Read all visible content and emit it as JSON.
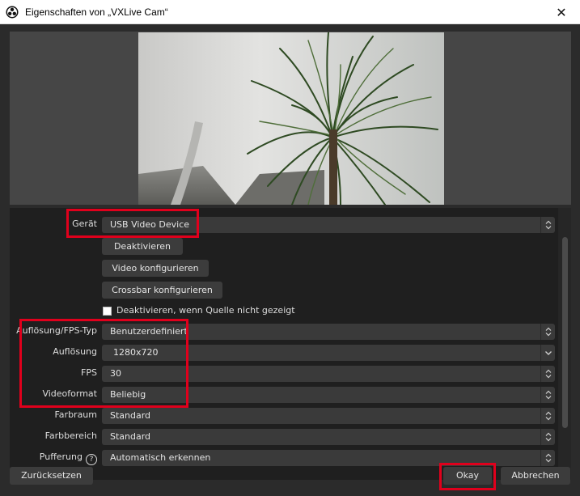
{
  "window": {
    "title": "Eigenschaften von „VXLive Cam“",
    "close_glyph": "✕"
  },
  "properties": {
    "device": {
      "label": "Gerät",
      "value": "USB Video Device"
    },
    "deactivate_button": "Deaktivieren",
    "configure_video_button": "Video konfigurieren",
    "configure_crossbar_button": "Crossbar konfigurieren",
    "deactivate_when_hidden": {
      "label": "Deaktivieren, wenn Quelle nicht gezeigt",
      "checked": false
    },
    "res_fps_type": {
      "label": "Auflösung/FPS-Typ",
      "value": "Benutzerdefiniert"
    },
    "resolution": {
      "label": "Auflösung",
      "value": "1280x720"
    },
    "fps": {
      "label": "FPS",
      "value": "30"
    },
    "video_format": {
      "label": "Videoformat",
      "value": "Beliebig"
    },
    "color_space": {
      "label": "Farbraum",
      "value": "Standard"
    },
    "color_range": {
      "label": "Farbbereich",
      "value": "Standard"
    },
    "buffering": {
      "label": "Pufferung",
      "value": "Automatisch erkennen",
      "help_glyph": "?"
    }
  },
  "footer": {
    "reset_button": "Zurücksetzen",
    "ok_button": "Okay",
    "cancel_button": "Abbrechen"
  },
  "colors": {
    "background": "#2b2b2b",
    "panel": "#1f1f1f",
    "field": "#3a3a3a",
    "highlight": "#e0001c"
  }
}
